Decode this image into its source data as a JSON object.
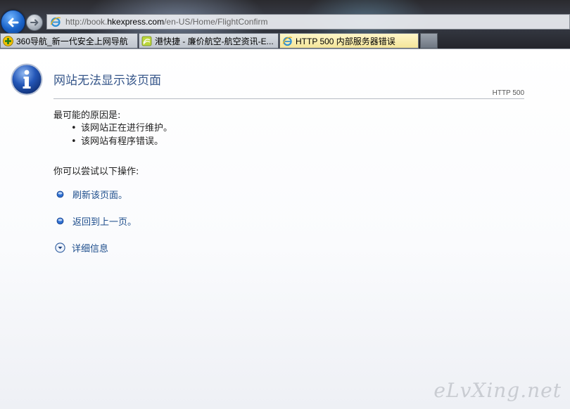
{
  "browser": {
    "address": {
      "url_prefix": "http://book.",
      "url_domain": "hkexpress.com",
      "url_path": "/en-US/Home/FlightConfirm"
    },
    "tabs": [
      {
        "label": "360导航_新一代安全上网导航",
        "icon": "360-plus-icon"
      },
      {
        "label": "港快捷 - 廉价航空-航空资讯-E...",
        "icon": "site-favicon"
      },
      {
        "label": "HTTP 500 内部服务器错误",
        "icon": "ie-icon",
        "active": true
      }
    ]
  },
  "error_page": {
    "title": "网站无法显示该页面",
    "code": "HTTP 500",
    "causes_heading": "最可能的原因是:",
    "causes": [
      "该网站正在进行维护。",
      "该网站有程序错误。"
    ],
    "actions_heading": "你可以尝试以下操作:",
    "actions": {
      "refresh": "刷新该页面。",
      "back": "返回到上一页。",
      "details": "详细信息"
    }
  },
  "watermark": "eLvXing.net",
  "colors": {
    "title": "#36568a",
    "link": "#1e4e8c",
    "active_tab": "#f4e59a"
  }
}
